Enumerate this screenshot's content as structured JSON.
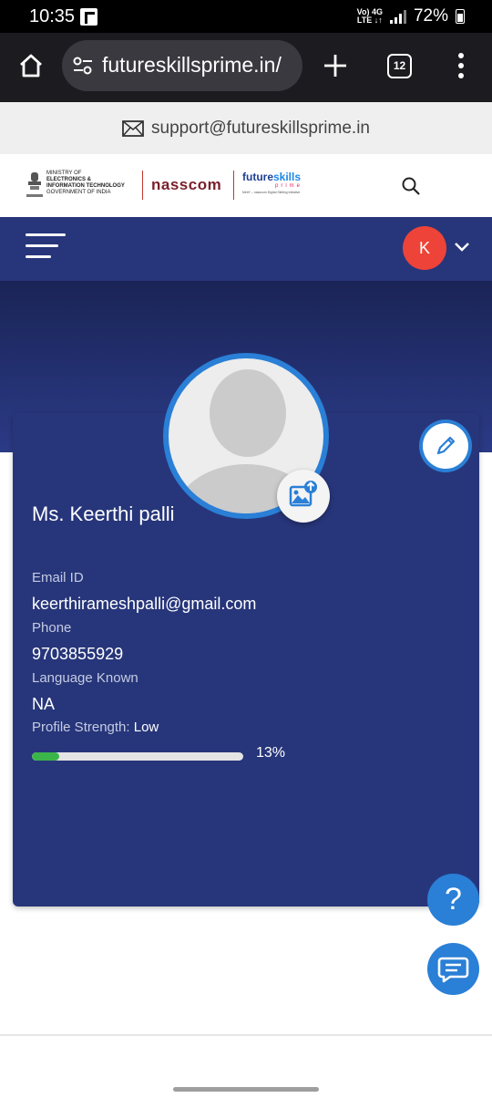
{
  "status_bar": {
    "time": "10:35",
    "network_top": "Vo) 4G",
    "network_bottom": "LTE ↓↑",
    "battery": "72%"
  },
  "browser": {
    "url": "futureskillsprime.in/",
    "tab_count": "12"
  },
  "support": {
    "email": "support@futureskillsprime.in"
  },
  "header": {
    "ministry_line1": "MINISTRY OF",
    "ministry_line2": "ELECTRONICS &",
    "ministry_line3": "INFORMATION TECHNOLOGY",
    "ministry_line4": "GOVERNMENT OF INDIA",
    "nasscom": "nasscom",
    "fs_main_a": "future",
    "fs_main_b": "skills",
    "fs_sub": "prime",
    "fs_tag": "MeitY – nasscom Digital Skilling Initiative"
  },
  "nav": {
    "avatar_initial": "K"
  },
  "profile": {
    "name": "Ms. Keerthi palli",
    "email_label": "Email ID",
    "email_value": "keerthirameshpalli@gmail.com",
    "phone_label": "Phone",
    "phone_value": "9703855929",
    "language_label": "Language Known",
    "language_value": "NA",
    "strength_label": "Profile Strength:",
    "strength_value": "Low",
    "progress_percent": "13%",
    "progress_fraction": 0.13
  },
  "colors": {
    "nav_blue": "#27367a",
    "accent_blue": "#2a7fd6",
    "avatar_red": "#ee4338",
    "progress_green": "#3bb54a"
  }
}
